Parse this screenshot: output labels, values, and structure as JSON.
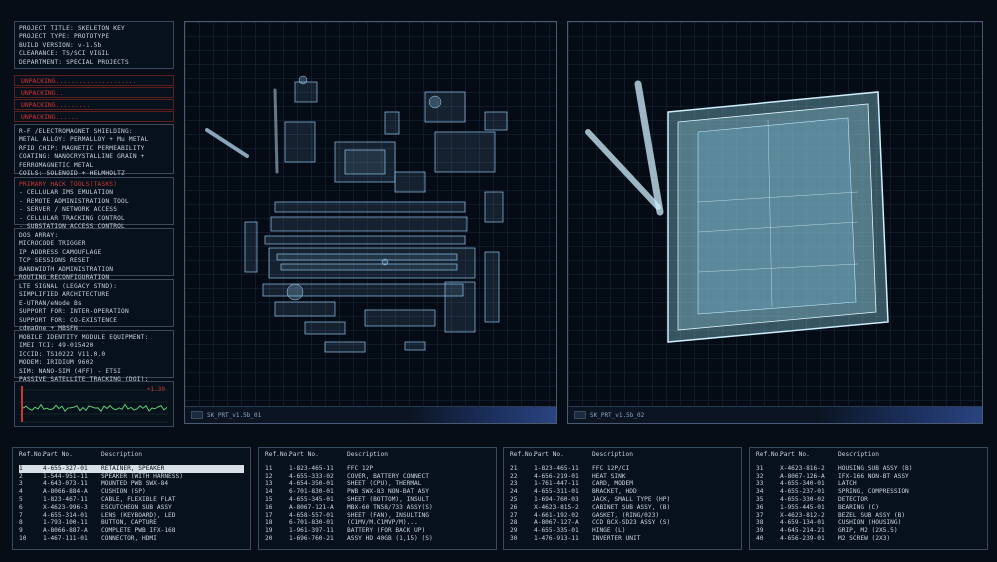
{
  "project": {
    "lines": [
      "PROJECT TITLE: SKELETON KEY",
      "PROJECT TYPE: PROTOTYPE",
      "BUILD VERSION: v-1.5b",
      "CLEARANCE: TS/SCI VIGIL",
      "DEPARTMENT: SPECIAL PROJECTS"
    ]
  },
  "unpacking": [
    "UNPACKING.....................",
    "UNPACKING..",
    "UNPACKING.........",
    "UNPACKING......"
  ],
  "shielding": {
    "lines": [
      "R-F /ELECTROMAGNET SHIELDING:",
      "METAL ALLOY: PERMALLOY + Mu METAL",
      "RFID CHIP: MAGNETIC PERMEABILITY",
      "COATING: NANOCRYSTALLINE GRAIN +",
      "FERROMAGNETIC METAL",
      "COILS: SOLENOID + HELMHOLTZ"
    ]
  },
  "hack_tools": {
    "title": "PRIMARY HACK TOOLS(TASKS)",
    "lines": [
      "- CELLULAR IMS EMULATION",
      "- REMOTE ADMINISTRATION TOOL",
      "- SERVER / NETWORK ACCESS",
      "- CELLULAR TRACKING CONTROL",
      "- SUBSTATION ACCESS CONTROL"
    ]
  },
  "dos": {
    "lines": [
      "DOS ARRAY:",
      "MICROCODE TRIGGER",
      "IP ADDRESS CAMOUFLAGE",
      "TCP SESSIONS RESET",
      "BANDWIDTH ADMINISTRATION",
      "ROUTING RECONFIGURATION"
    ]
  },
  "lte": {
    "lines": [
      "LTE SIGNAL (LEGACY STND):",
      "SIMPLIFIED ARCHITECTURE",
      "E-UTRAN/eNode Bs",
      "SUPPORT FOR: INTER-OPERATION",
      "SUPPORT FOR: CO-EXISTENCE",
      "cdmaOne + MBSFN"
    ]
  },
  "mobile": {
    "lines": [
      "MOBILE IDENTITY MODULE EQUIPMENT:",
      "IMEI TCI: 49-015420",
      "ICCID: TS10222 V11.0.0",
      "MODEM: IRIDIUM 9602",
      "SIM: NANO-SIM (4FF) - ETSI",
      "PASSIVE SATELLITE TRACKING (DOI):",
      "10.1109/ISSCAA.2010.5633903"
    ]
  },
  "graph": {
    "readout": "+1.30"
  },
  "viewports": [
    {
      "label": "SK_PRT_v1.5b_01"
    },
    {
      "label": "SK_PRT_v1.5b_02"
    }
  ],
  "parts_tables": [
    {
      "headers": [
        "Ref.No.",
        "Part No.",
        "Description"
      ],
      "rows": [
        [
          "1",
          "4-655-327-01",
          "RETAINER, SPEAKER"
        ],
        [
          "2",
          "1-544-951-11",
          "SPEAKER (WITH HARNESS)"
        ],
        [
          "3",
          "4-643-073-11",
          "MOUNTED PWB SWX-84"
        ],
        [
          "4",
          "A-8066-884-A",
          "CUSHION (SP)"
        ],
        [
          "5",
          "1-823-467-11",
          "CABLE, FLEXIBLE FLAT"
        ],
        [
          "6",
          "X-4623-996-3",
          "ESCUTCHEON SUB ASSY"
        ],
        [
          "7",
          "4-655-314-01",
          "LENS (KEYBOARD), LED"
        ],
        [
          "8",
          "1-793-100-11",
          "BUTTON, CAPTURE"
        ],
        [
          "9",
          "A-8066-887-A",
          "COMPLETE PWB IFX-168"
        ],
        [
          "10",
          "1-467-111-01",
          "CONNECTOR, HDMI"
        ]
      ]
    },
    {
      "headers": [
        "Ref.No.",
        "Part No.",
        "Description"
      ],
      "rows": [
        [
          "11",
          "1-823-465-11",
          "FFC 12P"
        ],
        [
          "12",
          "4-655-333-02",
          "COVER, BATTERY CONNECT"
        ],
        [
          "13",
          "4-654-350-01",
          "SHEET (CPU), THERMAL"
        ],
        [
          "14",
          "6-701-830-01",
          "PWB SWX-83 NON-BAT ASY"
        ],
        [
          "15",
          "4-655-345-01",
          "SHEET (BOTTOM), INSULT"
        ],
        [
          "16",
          "A-8067-121-A",
          "MBX-60 TN58/733 ASSY(S)"
        ],
        [
          "17",
          "4-658-557-01",
          "SHEET (FAN), INSULTING"
        ],
        [
          "18",
          "6-701-830-01",
          "(C1MV/M.C1MVP/M)..."
        ],
        [
          "19",
          "1-961-397-11",
          "BATTERY (FOR BACK UP)"
        ],
        [
          "20",
          "1-696-760-21",
          "ASSY HD 40GB (1,15) (S)"
        ]
      ]
    },
    {
      "headers": [
        "Ref.No.",
        "Part No.",
        "Description"
      ],
      "rows": [
        [
          "21",
          "1-823-465-11",
          "FFC 12P/CI"
        ],
        [
          "22",
          "4-656-219-01",
          "HEAT SINK"
        ],
        [
          "23",
          "1-761-447-11",
          "CARD, MODEM"
        ],
        [
          "24",
          "4-655-311-01",
          "BRACKET, HDD"
        ],
        [
          "25",
          "1-694-760-03",
          "JACK, SMALL TYPE (HP)"
        ],
        [
          "26",
          "X-4623-815-2",
          "CABINET SUB ASSY, (B)"
        ],
        [
          "27",
          "4-661-192-02",
          "GASKET, (RING/023)"
        ],
        [
          "28",
          "A-8067-127-A",
          "CCD BCX-SD23 ASSY (S)"
        ],
        [
          "29",
          "4-655-335-01",
          "HINGE (L)"
        ],
        [
          "30",
          "1-476-913-11",
          "INVERTER UNIT"
        ]
      ]
    },
    {
      "headers": [
        "Ref.No.",
        "Part No.",
        "Description"
      ],
      "rows": [
        [
          "31",
          "X-4623-816-2",
          "HOUSING SUB ASSY (B)"
        ],
        [
          "32",
          "A-8067-126-A",
          "IFX-166 NON-BT ASSY"
        ],
        [
          "33",
          "4-655-340-01",
          "LATCH"
        ],
        [
          "34",
          "4-655-237-01",
          "SPRING, COMPRESSION"
        ],
        [
          "35",
          "4-655-330-02",
          "DETECTOR"
        ],
        [
          "36",
          "1-955-445-01",
          "BEARING (C)"
        ],
        [
          "37",
          "X-4623-812-2",
          "BEZEL SUB ASSY (B)"
        ],
        [
          "38",
          "4-659-134-01",
          "CUSHION (HOUSING)"
        ],
        [
          "39",
          "4-645-214-21",
          "GRIP, M2 (2X5.5)"
        ],
        [
          "40",
          "4-656-239-01",
          "M2 SCREW (2X3)"
        ]
      ]
    }
  ],
  "colors": {
    "accent": "#9fd8ff",
    "alert": "#d83030",
    "selected_bg": "#d8dfe6"
  }
}
